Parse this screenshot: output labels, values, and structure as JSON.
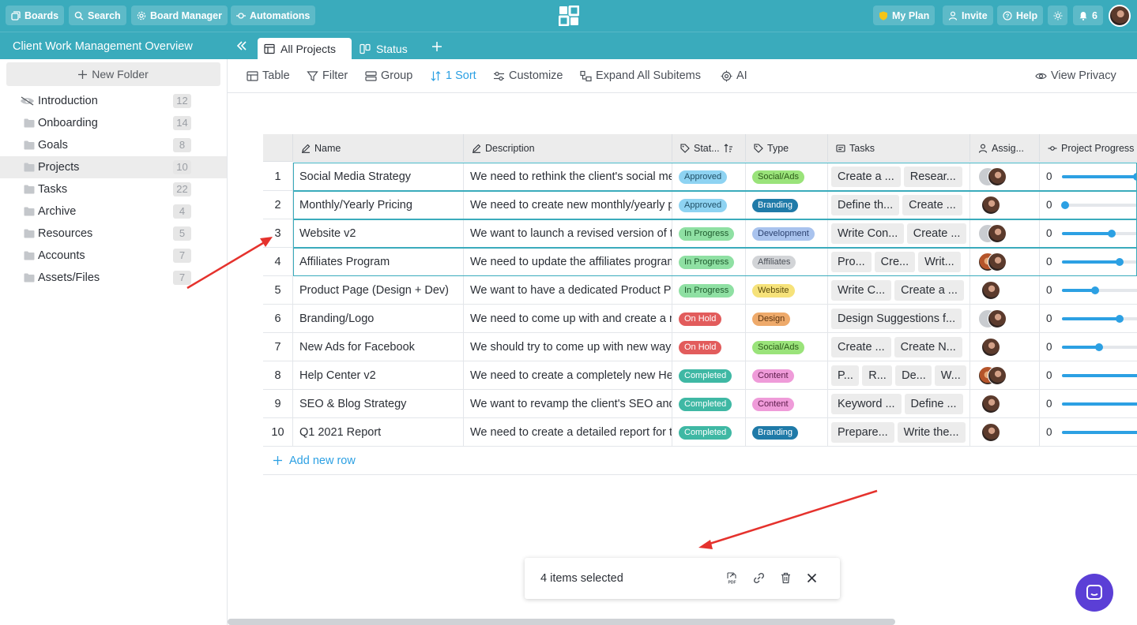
{
  "topbar": {
    "boards": "Boards",
    "search": "Search",
    "board_manager": "Board Manager",
    "automations": "Automations",
    "my_plan": "My Plan",
    "invite": "Invite",
    "help": "Help",
    "notifications_count": "6"
  },
  "board": {
    "title": "Client Work Management Overview",
    "tabs": [
      {
        "label": "All Projects"
      },
      {
        "label": "Status"
      }
    ]
  },
  "sidebar": {
    "new_folder": "New Folder",
    "folders": [
      {
        "label": "Introduction",
        "count": "12"
      },
      {
        "label": "Onboarding",
        "count": "14"
      },
      {
        "label": "Goals",
        "count": "8"
      },
      {
        "label": "Projects",
        "count": "10"
      },
      {
        "label": "Tasks",
        "count": "22"
      },
      {
        "label": "Archive",
        "count": "4"
      },
      {
        "label": "Resources",
        "count": "5"
      },
      {
        "label": "Accounts",
        "count": "7"
      },
      {
        "label": "Assets/Files",
        "count": "7"
      }
    ]
  },
  "toolbar": {
    "table": "Table",
    "filter": "Filter",
    "group": "Group",
    "sort": "1 Sort",
    "customize": "Customize",
    "expand": "Expand All Subitems",
    "ai": "AI",
    "view_privacy": "View Privacy"
  },
  "grid": {
    "headers": {
      "name": "Name",
      "description": "Description",
      "status": "Stat...",
      "type": "Type",
      "tasks": "Tasks",
      "assignee": "Assig...",
      "progress": "Project Progress"
    },
    "rows": [
      {
        "num": "1",
        "name": "Social Media Strategy",
        "desc": "We need to rethink the client's social media strategy",
        "status": "Approved",
        "type": "Social/Ads",
        "tasks": [
          "Create a ...",
          "Resear..."
        ],
        "avatars": [
          "gray",
          "photo"
        ],
        "progress_label": "0",
        "progress": 0.86
      },
      {
        "num": "2",
        "name": "Monthly/Yearly Pricing",
        "desc": "We need to create new monthly/yearly pricing",
        "status": "Approved",
        "type": "Branding",
        "tasks": [
          "Define th...",
          "Create ..."
        ],
        "avatars": [
          "photo"
        ],
        "progress_label": "0",
        "progress": 0.04
      },
      {
        "num": "3",
        "name": "Website v2",
        "desc": "We want to launch a revised version of the website",
        "status": "In Progress",
        "type": "Development",
        "tasks": [
          "Write Con...",
          "Create ..."
        ],
        "avatars": [
          "gray",
          "photo"
        ],
        "progress_label": "0",
        "progress": 0.57
      },
      {
        "num": "4",
        "name": "Affiliates Program",
        "desc": "We need to update the affiliates program",
        "status": "In Progress",
        "type": "Affiliates",
        "tasks": [
          "Pro...",
          "Cre...",
          "Writ..."
        ],
        "avatars": [
          "photo2",
          "photo"
        ],
        "progress_label": "0",
        "progress": 0.66
      },
      {
        "num": "5",
        "name": "Product Page (Design + Dev)",
        "desc": "We want to have a dedicated Product Page",
        "status": "In Progress",
        "type": "Website",
        "tasks": [
          "Write C...",
          "Create a ..."
        ],
        "avatars": [
          "photo"
        ],
        "progress_label": "0",
        "progress": 0.38
      },
      {
        "num": "6",
        "name": "Branding/Logo",
        "desc": "We need to come up with and create a new logo",
        "status": "On Hold",
        "type": "Design",
        "tasks": [
          "Design Suggestions f..."
        ],
        "avatars": [
          "gray",
          "photo"
        ],
        "progress_label": "0",
        "progress": 0.66
      },
      {
        "num": "7",
        "name": "New Ads for Facebook",
        "desc": "We should try to come up with new ways",
        "status": "On Hold",
        "type": "Social/Ads",
        "tasks": [
          "Create ...",
          "Create N..."
        ],
        "avatars": [
          "photo"
        ],
        "progress_label": "0",
        "progress": 0.43
      },
      {
        "num": "8",
        "name": "Help Center v2",
        "desc": "We need to create a completely new Help Center",
        "status": "Completed",
        "type": "Content",
        "tasks": [
          "P...",
          "R...",
          "De...",
          "W..."
        ],
        "avatars": [
          "photo2",
          "photo"
        ],
        "progress_label": "0",
        "progress": 1.0
      },
      {
        "num": "9",
        "name": "SEO & Blog Strategy",
        "desc": "We want to revamp the client's SEO and blog strategy",
        "status": "Completed",
        "type": "Content",
        "tasks": [
          "Keyword ...",
          "Define ..."
        ],
        "avatars": [
          "photo"
        ],
        "progress_label": "0",
        "progress": 1.0
      },
      {
        "num": "10",
        "name": "Q1 2021 Report",
        "desc": "We need to create a detailed report for the quarter",
        "status": "Completed",
        "type": "Branding",
        "tasks": [
          "Prepare...",
          "Write the..."
        ],
        "avatars": [
          "photo"
        ],
        "progress_label": "0",
        "progress": 1.0
      }
    ],
    "add_row": "Add new row"
  },
  "status_colors": {
    "Approved": {
      "bg": "#8ed3f2",
      "fg": "#1f4f66"
    },
    "In Progress": {
      "bg": "#8fe0a3",
      "fg": "#1e5a2d"
    },
    "On Hold": {
      "bg": "#e25c5c",
      "fg": "#ffffff"
    },
    "Completed": {
      "bg": "#3fb8a4",
      "fg": "#ffffff"
    }
  },
  "type_colors": {
    "Social/Ads": {
      "bg": "#9ae37a",
      "fg": "#2c5a18"
    },
    "Branding": {
      "bg": "#1f7aa8",
      "fg": "#ffffff"
    },
    "Development": {
      "bg": "#a9c3ee",
      "fg": "#2c4270"
    },
    "Affiliates": {
      "bg": "#d2d4d7",
      "fg": "#4a4f57"
    },
    "Website": {
      "bg": "#f6e27a",
      "fg": "#5c4c0e"
    },
    "Design": {
      "bg": "#eeaa6b",
      "fg": "#5a330f"
    },
    "Content": {
      "bg": "#ef9bd9",
      "fg": "#5c1c4a"
    }
  },
  "selection_bar": {
    "text": "4 items selected",
    "selected_rows": [
      1,
      2,
      3,
      4
    ]
  },
  "colors": {
    "brand": "#3aabbc",
    "accent": "#2ca0e3",
    "chat": "#5b3fd6",
    "annotation": "#e5322d"
  }
}
